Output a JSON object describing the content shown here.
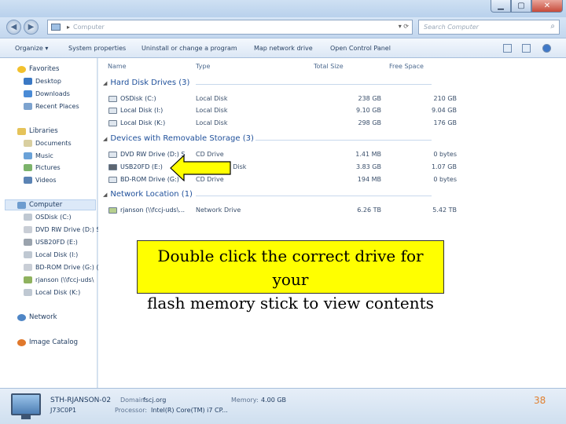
{
  "window": {
    "minimize_glyph": "▁",
    "maximize_glyph": "▢",
    "close_glyph": "✕"
  },
  "address": {
    "arrow": "▸",
    "location": "Computer",
    "right_glyphs": "▾ ⟳"
  },
  "search": {
    "placeholder": "Search Computer",
    "icon": "⌕"
  },
  "toolbar": {
    "organize": "Organize ▾",
    "system_properties": "System properties",
    "uninstall": "Uninstall or change a program",
    "map_drive": "Map network drive",
    "control_panel": "Open Control Panel"
  },
  "nav": {
    "favorites": "Favorites",
    "desktop": "Desktop",
    "downloads": "Downloads",
    "recent": "Recent Places",
    "libraries": "Libraries",
    "documents": "Documents",
    "music": "Music",
    "pictures": "Pictures",
    "videos": "Videos",
    "computer": "Computer",
    "drives": [
      "OSDisk (C:)",
      "DVD RW Drive (D:) S",
      "USB20FD (E:)",
      "Local Disk (I:)",
      "BD-ROM Drive (G:) (",
      "rjanson (\\\\fccj-uds\\",
      "Local Disk (K:)"
    ],
    "network": "Network",
    "image_catalog": "Image Catalog"
  },
  "columns": {
    "name": "Name",
    "type": "Type",
    "total": "Total Size",
    "free": "Free Space"
  },
  "groups": {
    "hard_disks": "Hard Disk Drives (3)",
    "removable": "Devices with Removable Storage (3)",
    "network": "Network Location (1)"
  },
  "hard_disks": [
    {
      "name": "OSDisk (C:)",
      "type": "Local Disk",
      "total": "238 GB",
      "free": "210 GB"
    },
    {
      "name": "Local Disk (I:)",
      "type": "Local Disk",
      "total": "9.10 GB",
      "free": "9.04 GB"
    },
    {
      "name": "Local Disk (K:)",
      "type": "Local Disk",
      "total": "298 GB",
      "free": "176 GB"
    }
  ],
  "removable": [
    {
      "name": "DVD RW Drive (D:) S",
      "type": "CD Drive",
      "total": "1.41 MB",
      "free": "0 bytes"
    },
    {
      "name": "USB20FD (E:)",
      "type": "Removable Disk",
      "total": "3.83 GB",
      "free": "1.07 GB"
    },
    {
      "name": "BD-ROM Drive (G:)",
      "type": "CD Drive",
      "total": "194 MB",
      "free": "0 bytes"
    }
  ],
  "network_locations": [
    {
      "name": "rjanson (\\\\fccj-uds\\...",
      "type": "Network Drive",
      "total": "6.26 TB",
      "free": "5.42 TB"
    }
  ],
  "details": {
    "computer_name": "STH-RJANSON-02",
    "workgroup": "J73C0P1",
    "domain_label": "Domain:",
    "domain_value": "fscj.org",
    "memory_label": "Memory:",
    "memory_value": "4.00 GB",
    "processor_label": "Processor:",
    "processor_value": "Intel(R) Core(TM) i7 CP..."
  },
  "callout": {
    "line1": "Double click the correct drive for your",
    "line2": "flash memory stick to view contents"
  },
  "page_number": "38",
  "colors": {
    "callout_bg": "#ffff00",
    "arrow_fill": "#ffff00",
    "page_number": "#e08030"
  }
}
